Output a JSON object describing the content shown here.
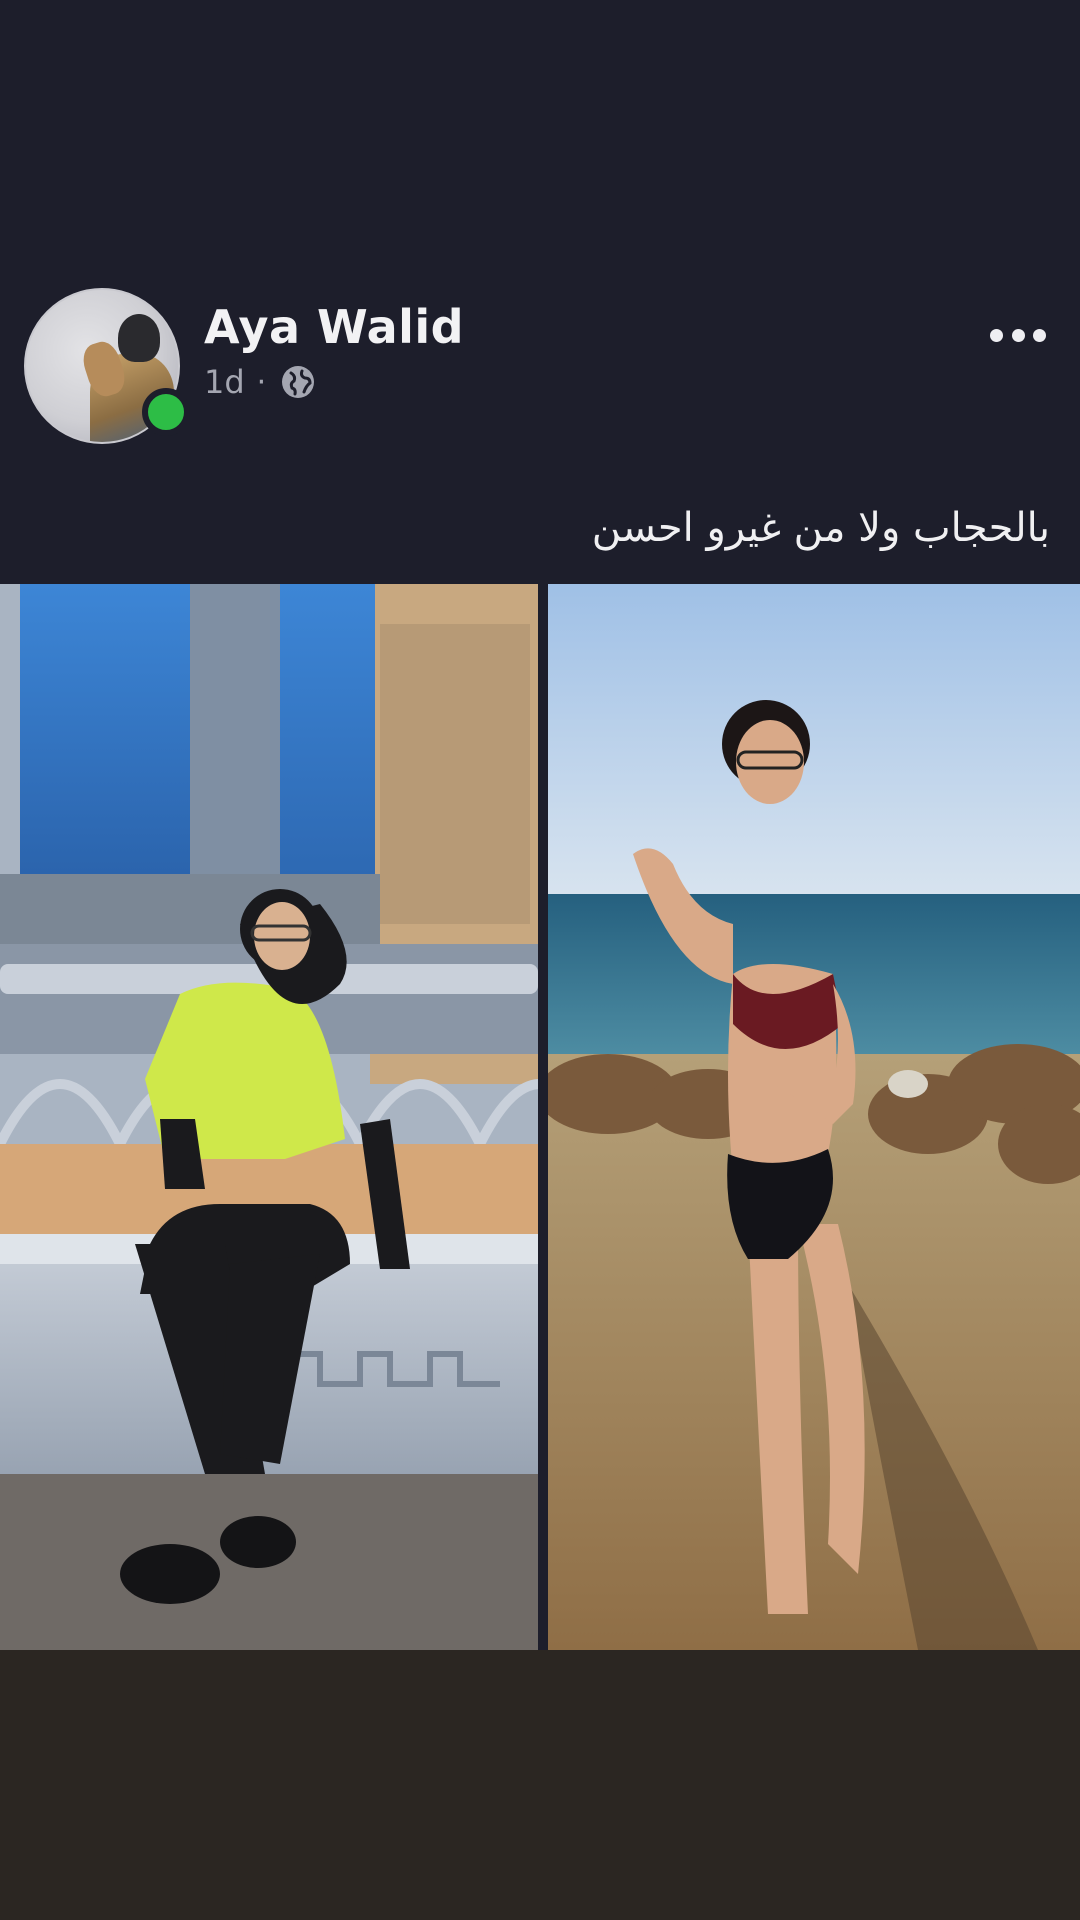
{
  "post": {
    "author": "Aya Walid",
    "time": "1d",
    "separator": "·",
    "privacy_icon": "globe-icon",
    "more_icon": "more-options-icon",
    "caption": "بالحجاب ولا من غيرو احسن",
    "online": true
  },
  "photos": [
    {
      "icon": "photo-left",
      "subject": "hijab-outfit"
    },
    {
      "icon": "photo-right",
      "subject": "beach-swimsuit"
    }
  ],
  "colors": {
    "background": "#1d1e2b",
    "bottom_band": "#2b2622",
    "name_text": "#f2f2f4",
    "meta_text": "#a4a6b1",
    "online": "#2dbd46"
  }
}
